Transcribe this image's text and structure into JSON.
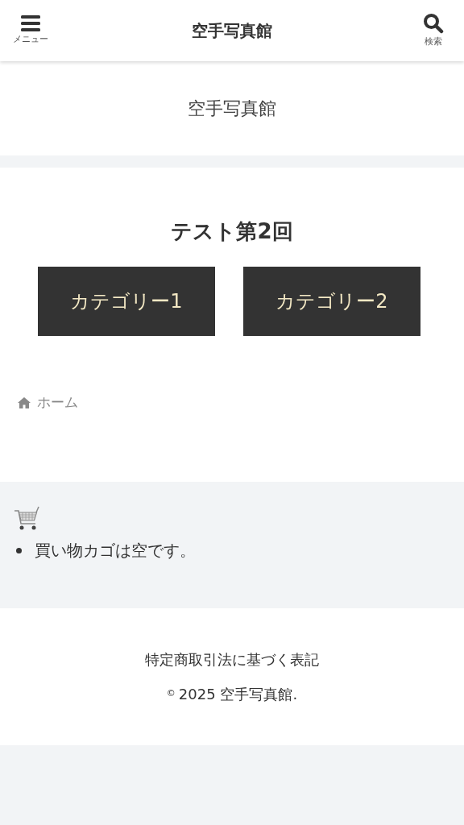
{
  "header": {
    "menu_label": "メニュー",
    "title": "空手写真館",
    "search_label": "検索"
  },
  "site_title": "空手写真館",
  "page": {
    "heading": "テスト第2回",
    "categories": [
      {
        "label": "カテゴリー1"
      },
      {
        "label": "カテゴリー2"
      }
    ]
  },
  "breadcrumb": {
    "home": "ホーム"
  },
  "cart": {
    "items": [
      "買い物カゴは空です。"
    ]
  },
  "footer": {
    "link": "特定商取引法に基づく表記",
    "copyright_symbol": "©",
    "copyright": "2025 空手写真館."
  }
}
